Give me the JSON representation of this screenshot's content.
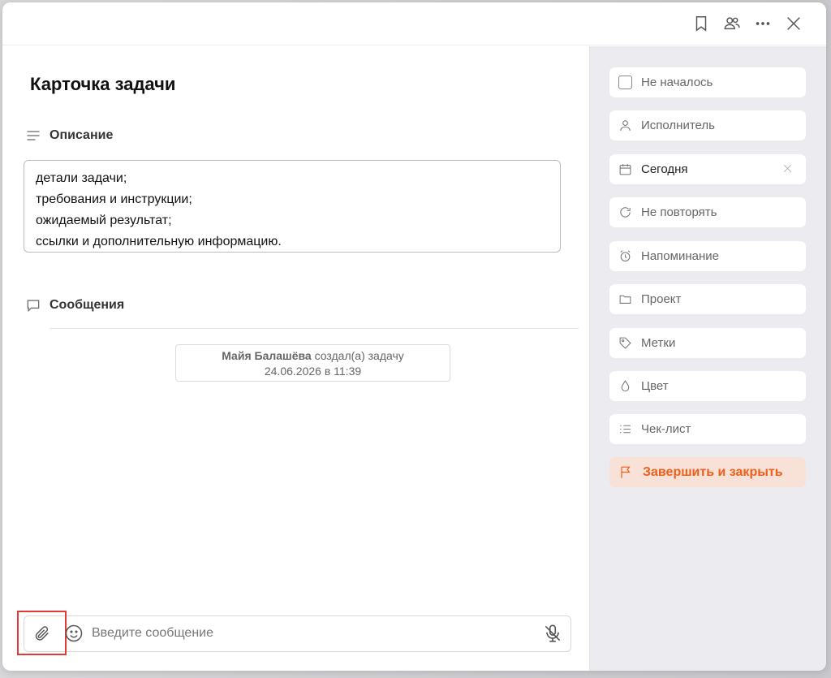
{
  "card": {
    "title": "Карточка задачи"
  },
  "description": {
    "heading": "Описание",
    "lines": [
      "детали задачи;",
      "требования и инструкции;",
      "ожидаемый результат;",
      "ссылки и дополнительную информацию."
    ]
  },
  "messages": {
    "heading": "Сообщения",
    "event": {
      "author": "Майя Балашёва",
      "action": "создал(а) задачу",
      "datetime": "24.06.2026 в 11:39"
    },
    "composer": {
      "placeholder": "Введите сообщение",
      "value": ""
    }
  },
  "topbar": {
    "icons": [
      "bookmark-icon",
      "users-icon",
      "more-icon",
      "close-icon"
    ]
  },
  "sidebar": {
    "items": [
      {
        "label": "Не началось",
        "icon": "checkbox-icon"
      },
      {
        "label": "Исполнитель",
        "icon": "person-icon"
      },
      {
        "label": "Сегодня",
        "icon": "calendar-icon"
      },
      {
        "label": "Не повторять",
        "icon": "repeat-icon"
      },
      {
        "label": "Напоминание",
        "icon": "alarm-icon"
      },
      {
        "label": "Проект",
        "icon": "folder-icon"
      },
      {
        "label": "Метки",
        "icon": "tag-icon"
      },
      {
        "label": "Цвет",
        "icon": "drop-icon"
      },
      {
        "label": "Чек-лист",
        "icon": "checklist-icon"
      },
      {
        "label": "Завершить и закрыть",
        "icon": "flag-icon"
      }
    ]
  },
  "colors": {
    "accent": "#ef5f1c",
    "accent_bg": "#f8e1d7",
    "highlight": "#e53935",
    "sidebar_bg": "#ececf0"
  }
}
